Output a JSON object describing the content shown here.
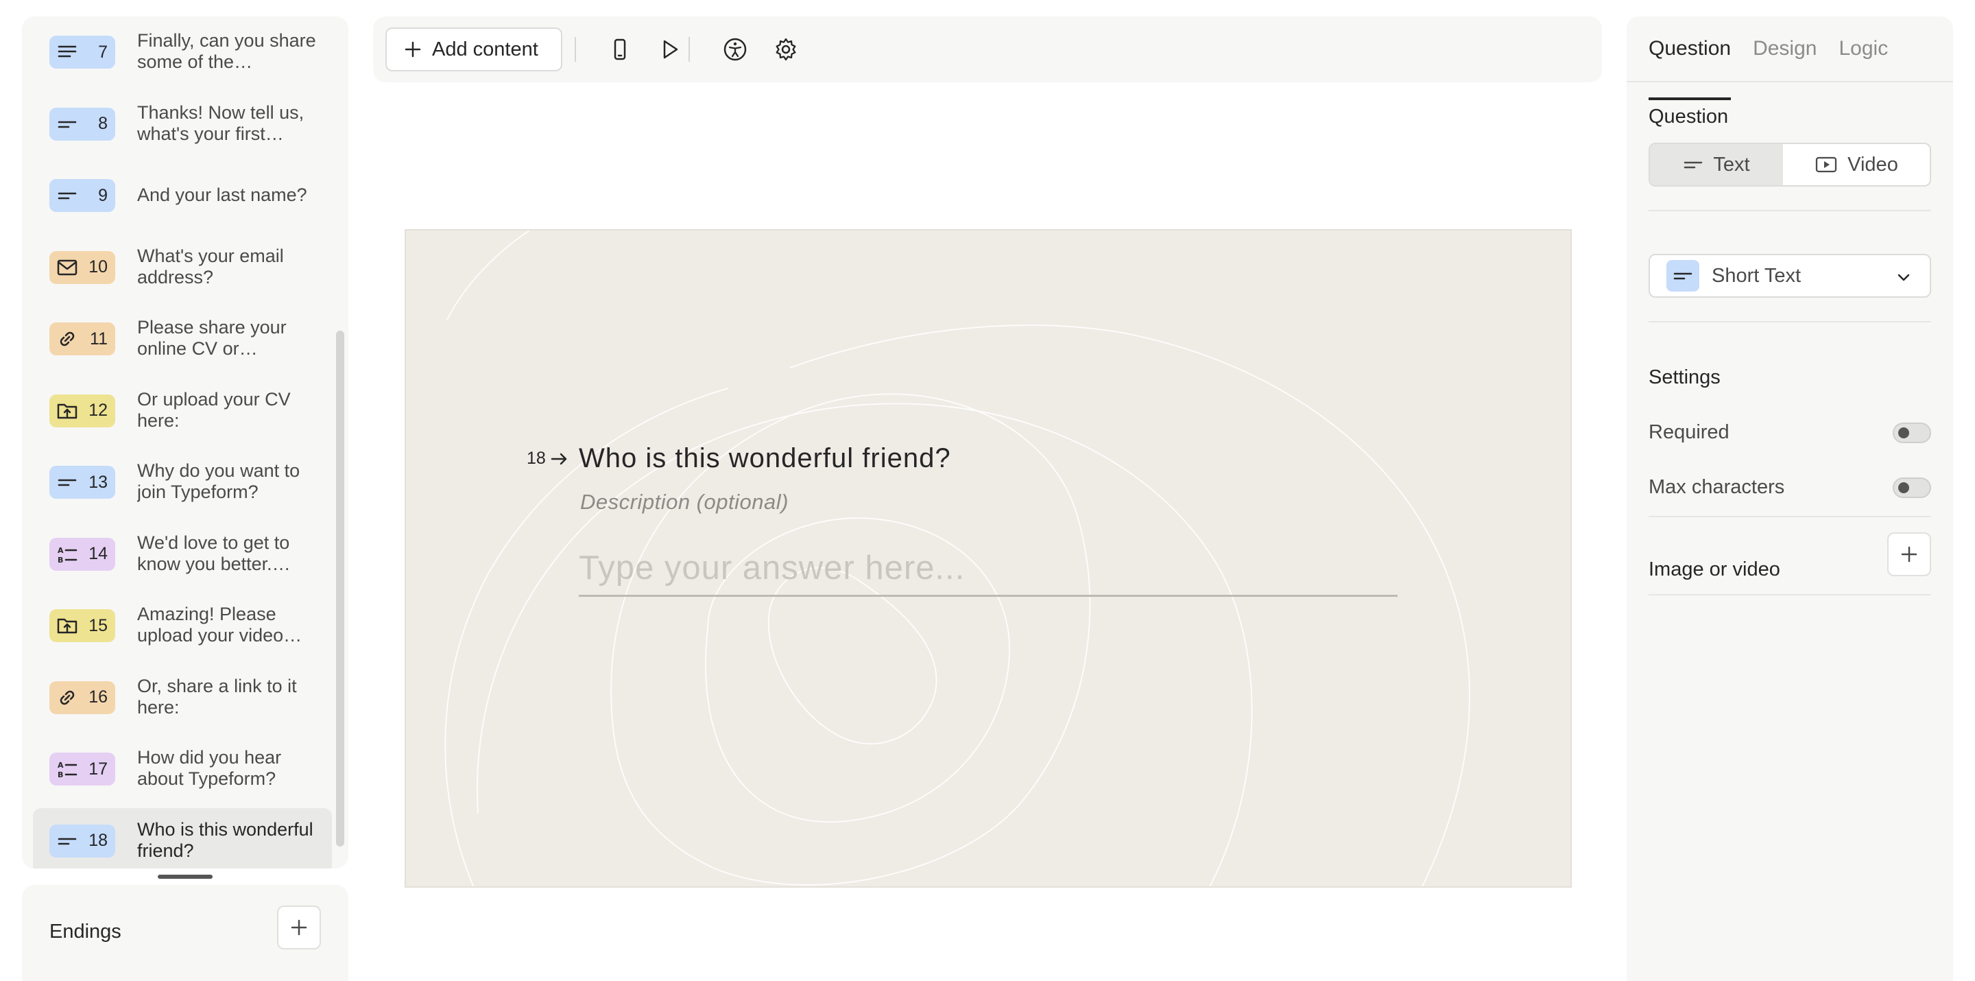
{
  "sidebar": {
    "questions": [
      {
        "num": "7",
        "label": "Finally, can you share some of the…",
        "color": "blue",
        "icon": "long-text-icon"
      },
      {
        "num": "8",
        "label": "Thanks! Now tell us, what's your first…",
        "color": "blue",
        "icon": "short-text-icon"
      },
      {
        "num": "9",
        "label": "And your last name?",
        "color": "blue",
        "icon": "short-text-icon"
      },
      {
        "num": "10",
        "label": "What's your email address?",
        "color": "orange",
        "icon": "email-icon"
      },
      {
        "num": "11",
        "label": "Please share your online CV or…",
        "color": "orange",
        "icon": "link-icon"
      },
      {
        "num": "12",
        "label": "Or upload your CV here:",
        "color": "yellow",
        "icon": "file-upload-icon"
      },
      {
        "num": "13",
        "label": "Why do you want to join Typeform?",
        "color": "blue",
        "icon": "short-text-icon"
      },
      {
        "num": "14",
        "label": "We'd love to get to know you better.…",
        "color": "purple",
        "icon": "multiple-choice-icon"
      },
      {
        "num": "15",
        "label": "Amazing! Please upload your video…",
        "color": "yellow",
        "icon": "file-upload-icon"
      },
      {
        "num": "16",
        "label": "Or, share a link to it here:",
        "color": "orange",
        "icon": "link-icon"
      },
      {
        "num": "17",
        "label": "How did you hear about Typeform?",
        "color": "purple",
        "icon": "multiple-choice-icon"
      },
      {
        "num": "18",
        "label": "Who is this wonderful friend?",
        "color": "blue",
        "icon": "short-text-icon",
        "active": true
      }
    ],
    "endings_label": "Endings"
  },
  "toolbar": {
    "add_content_label": "Add content",
    "icons": [
      "mobile-preview-icon",
      "play-icon",
      "accessibility-icon",
      "settings-gear-icon"
    ]
  },
  "canvas": {
    "question_number": "18",
    "question_title": "Who is this wonderful friend?",
    "description_placeholder": "Description (optional)",
    "answer_placeholder": "Type your answer here..."
  },
  "right_panel": {
    "tabs": [
      "Question",
      "Design",
      "Logic"
    ],
    "active_tab": "Question",
    "question_heading": "Question",
    "segments": [
      "Text",
      "Video"
    ],
    "active_segment": "Text",
    "question_type": "Short Text",
    "settings_heading": "Settings",
    "settings": [
      {
        "label": "Required",
        "on": false
      },
      {
        "label": "Max characters",
        "on": false
      }
    ],
    "media_heading": "Image or video"
  },
  "colors": {
    "blue": "#c5dcfb",
    "orange": "#f4d6ac",
    "yellow": "#eee391",
    "purple": "#e5cff3",
    "canvas_bg": "#efebe5",
    "panel_bg": "#f7f7f6"
  }
}
